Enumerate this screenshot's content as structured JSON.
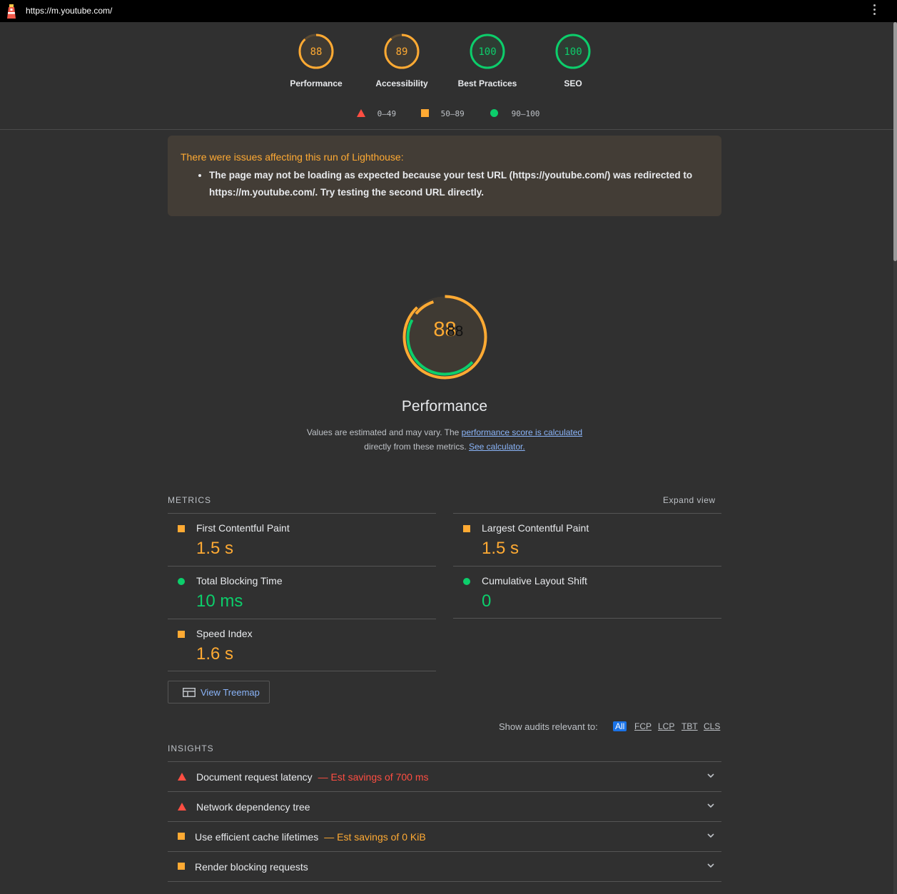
{
  "topbar": {
    "url": "https://m.youtube.com/"
  },
  "gauges": [
    {
      "score": "88",
      "label": "Performance",
      "status": "average"
    },
    {
      "score": "89",
      "label": "Accessibility",
      "status": "average"
    },
    {
      "score": "100",
      "label": "Best Practices",
      "status": "pass"
    },
    {
      "score": "100",
      "label": "SEO",
      "status": "pass"
    }
  ],
  "legend": {
    "fail": "0–49",
    "average": "50–89",
    "pass": "90–100"
  },
  "warning": {
    "title": "There were issues affecting this run of Lighthouse:",
    "items": [
      "The page may not be loading as expected because your test URL (https://youtube.com/) was redirected to https://m.youtube.com/. Try testing the second URL directly."
    ]
  },
  "performance": {
    "score": "88",
    "title": "Performance",
    "desc_before": "Values are estimated and may vary. The ",
    "desc_link1": "performance score is calculated",
    "desc_mid": "directly from these metrics.",
    "desc_link2": "See calculator."
  },
  "metrics": {
    "heading": "METRICS",
    "expand_label": "Expand view",
    "items": [
      {
        "title": "First Contentful Paint",
        "value": "1.5 s",
        "status": "average"
      },
      {
        "title": "Largest Contentful Paint",
        "value": "1.5 s",
        "status": "average"
      },
      {
        "title": "Total Blocking Time",
        "value": "10 ms",
        "status": "pass"
      },
      {
        "title": "Cumulative Layout Shift",
        "value": "0",
        "status": "pass"
      },
      {
        "title": "Speed Index",
        "value": "1.6 s",
        "status": "average"
      }
    ]
  },
  "treemap": {
    "label": "View Treemap"
  },
  "filter": {
    "label": "Show audits relevant to:",
    "options": [
      "All",
      "FCP",
      "LCP",
      "TBT",
      "CLS"
    ],
    "active": "All"
  },
  "insights": {
    "heading": "INSIGHTS",
    "items": [
      {
        "title": "Document request latency",
        "savings": "— Est savings of 700 ms",
        "status": "fail"
      },
      {
        "title": "Network dependency tree",
        "savings": "",
        "status": "fail"
      },
      {
        "title": "Use efficient cache lifetimes",
        "savings": "— Est savings of 0 KiB",
        "status": "average"
      },
      {
        "title": "Render blocking requests",
        "savings": "",
        "status": "average"
      }
    ]
  },
  "colors": {
    "pass": "#0cce6b",
    "average": "#ffaa33",
    "fail": "#ff4e42",
    "link": "#8ab4f8",
    "background": "#303030"
  }
}
